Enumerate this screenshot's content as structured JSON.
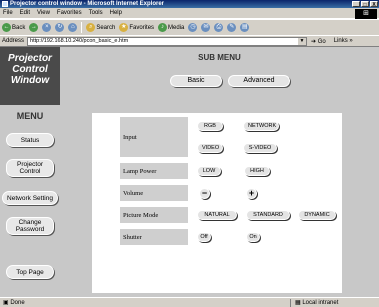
{
  "window": {
    "title": "Projector control window - Microsoft Internet Explorer",
    "minimize": "_",
    "maximize": "□",
    "close": "X"
  },
  "menubar": [
    "File",
    "Edit",
    "View",
    "Favorites",
    "Tools",
    "Help"
  ],
  "toolbar": {
    "back": "Back",
    "search": "Search",
    "favorites": "Favorites",
    "media": "Media"
  },
  "address": {
    "label": "Address",
    "url": "http://192.168.10.240/pcon_basic_e.htm",
    "go": "Go",
    "links": "Links"
  },
  "brand": {
    "line1": "Projector",
    "line2": "Control",
    "line3": "Window"
  },
  "submenu": {
    "title": "SUB MENU",
    "basic": "Basic",
    "advanced": "Advanced"
  },
  "menu": {
    "title": "MENU",
    "items": [
      "Status",
      "Projector Control",
      "Network Setting",
      "Change Password",
      "Top Page"
    ]
  },
  "controls": {
    "input": {
      "label": "Input",
      "buttons": [
        "RGB",
        "NETWORK",
        "VIDEO",
        "S-VIDEO"
      ]
    },
    "lamp": {
      "label": "Lamp Power",
      "buttons": [
        "LOW",
        "HIGH"
      ]
    },
    "volume": {
      "label": "Volume",
      "minus": "−",
      "plus": "+"
    },
    "picture": {
      "label": "Picture Mode",
      "buttons": [
        "NATURAL",
        "STANDARD",
        "DYNAMIC"
      ]
    },
    "shutter": {
      "label": "Shutter",
      "buttons": [
        "Off",
        "On"
      ]
    }
  },
  "status": {
    "left": "Done",
    "zone": "Local intranet"
  }
}
